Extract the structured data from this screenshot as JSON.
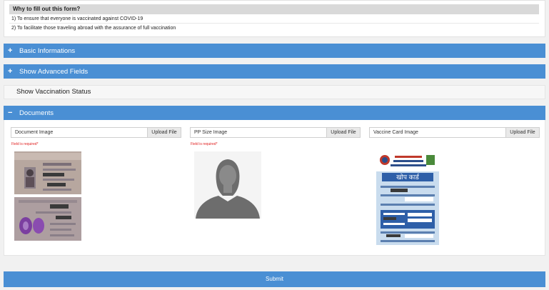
{
  "why": {
    "title": "Why to fill out this form?",
    "line1": "1) To ensure that everyone is vaccinated against COVID-19",
    "line2": "2) To facilitate those traveling abroad with the assurance of full vaccination"
  },
  "sections": {
    "basic": {
      "symbol": "+",
      "label": "Basic Informations"
    },
    "advanced": {
      "symbol": "+",
      "label": "Show Advanced Fields"
    },
    "status": {
      "label": "Show Vaccination Status"
    },
    "documents": {
      "symbol": "−",
      "label": "Documents"
    }
  },
  "documents": {
    "required_text": "Field is required*",
    "upload_label": "Upload File",
    "items": [
      {
        "name": "Document Image"
      },
      {
        "name": "PP Size Image"
      },
      {
        "name": "Vaccine Card Image"
      }
    ]
  },
  "vaccine_card": {
    "heading": "खोप कार्ड"
  },
  "submit_label": "Submit",
  "colors": {
    "accent": "#4a8fd4",
    "required": "#e02020"
  }
}
